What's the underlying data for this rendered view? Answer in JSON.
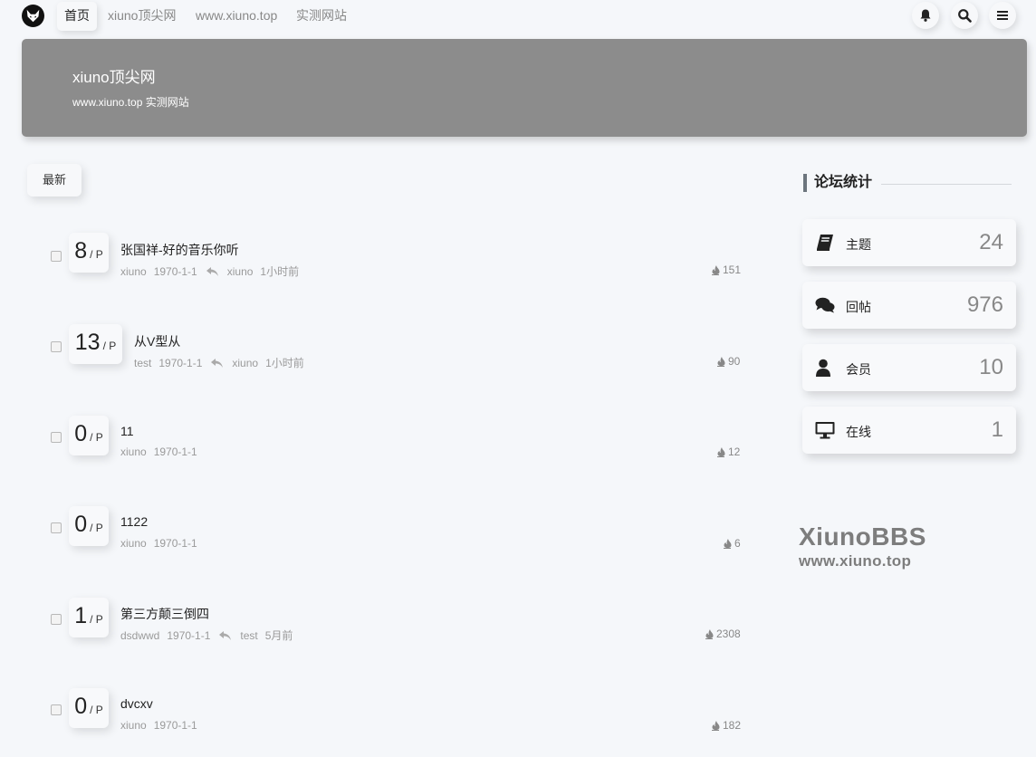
{
  "nav": {
    "items": [
      {
        "label": "首页",
        "active": true
      },
      {
        "label": "xiuno顶尖网"
      },
      {
        "label": "www.xiuno.top"
      },
      {
        "label": "实测网站"
      }
    ]
  },
  "banner": {
    "title": "xiuno顶尖网",
    "subtitle": "www.xiuno.top 实测网站",
    "bg_color": "#8c8c8c"
  },
  "tabs": {
    "latest": "最新"
  },
  "threads": [
    {
      "pages": "8",
      "unit": "/ P",
      "title": "张国祥-好的音乐你听",
      "author": "xiuno",
      "date": "1970-1-1",
      "last_user": "xiuno",
      "last_time": "1小时前",
      "views": "151"
    },
    {
      "pages": "13",
      "unit": "/ P",
      "title": "从V型从",
      "author": "test",
      "date": "1970-1-1",
      "last_user": "xiuno",
      "last_time": "1小时前",
      "views": "90"
    },
    {
      "pages": "0",
      "unit": "/ P",
      "title": "11",
      "author": "xiuno",
      "date": "1970-1-1",
      "views": "12"
    },
    {
      "pages": "0",
      "unit": "/ P",
      "title": "1122",
      "author": "xiuno",
      "date": "1970-1-1",
      "views": "6"
    },
    {
      "pages": "1",
      "unit": "/ P",
      "title": "第三方颠三倒四",
      "author": "dsdwwd",
      "date": "1970-1-1",
      "last_user": "test",
      "last_time": "5月前",
      "views": "2308"
    },
    {
      "pages": "0",
      "unit": "/ P",
      "title": "dvcxv",
      "author": "xiuno",
      "date": "1970-1-1",
      "views": "182"
    }
  ],
  "sidebar": {
    "heading": "论坛统计",
    "stats": [
      {
        "icon": "book-icon",
        "label": "主题",
        "value": "24"
      },
      {
        "icon": "comments-icon",
        "label": "回帖",
        "value": "976"
      },
      {
        "icon": "user-icon",
        "label": "会员",
        "value": "10"
      },
      {
        "icon": "monitor-icon",
        "label": "在线",
        "value": "1"
      }
    ],
    "brand": {
      "name": "XiunoBBS",
      "url": "www.xiuno.top"
    }
  }
}
